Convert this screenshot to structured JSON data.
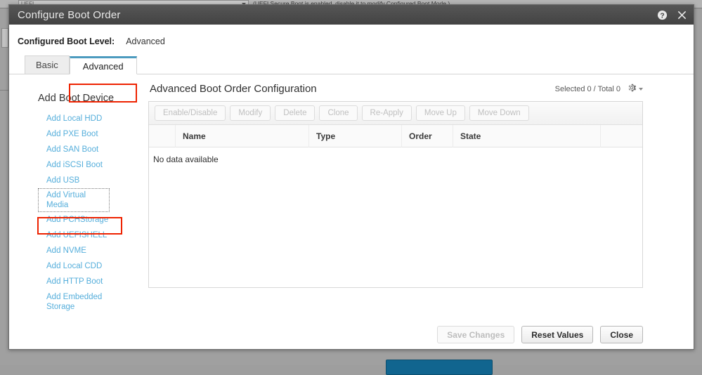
{
  "background": {
    "select_value": "UEFI",
    "note": "(UEFI Secure Boot is enabled, disable it to modify Configured Boot Mode.)"
  },
  "window": {
    "title": "Configure Boot Order",
    "help_icon": "help-circle-icon",
    "close_icon": "close-icon"
  },
  "boot_level": {
    "label": "Configured Boot Level:",
    "value": "Advanced"
  },
  "tabs": [
    {
      "label": "Basic",
      "active": false
    },
    {
      "label": "Advanced",
      "active": true
    }
  ],
  "sidebar": {
    "title": "Add Boot Device",
    "items": [
      {
        "label": "Add Local HDD"
      },
      {
        "label": "Add PXE Boot"
      },
      {
        "label": "Add SAN Boot"
      },
      {
        "label": "Add iSCSI Boot"
      },
      {
        "label": "Add USB"
      },
      {
        "label": "Add Virtual Media"
      },
      {
        "label": "Add PCHStorage"
      },
      {
        "label": "Add UEFISHELL"
      },
      {
        "label": "Add NVME"
      },
      {
        "label": "Add Local CDD"
      },
      {
        "label": "Add HTTP Boot"
      },
      {
        "label": "Add Embedded Storage"
      }
    ]
  },
  "main": {
    "title": "Advanced Boot Order Configuration",
    "selected_total": "Selected 0 / Total 0",
    "gear_icon": "gear-icon",
    "toolbar": [
      {
        "label": "Enable/Disable"
      },
      {
        "label": "Modify"
      },
      {
        "label": "Delete"
      },
      {
        "label": "Clone"
      },
      {
        "label": "Re-Apply"
      },
      {
        "label": "Move Up"
      },
      {
        "label": "Move Down"
      }
    ],
    "columns": [
      "",
      "Name",
      "Type",
      "Order",
      "State",
      ""
    ],
    "empty_message": "No data available"
  },
  "footer": {
    "save": "Save Changes",
    "reset": "Reset Values",
    "close": "Close"
  },
  "colors": {
    "link": "#55aedb",
    "accent_tab": "#4c9bbf",
    "highlight": "#ee2200",
    "titlebar": "#484848",
    "bg_button": "#11658f"
  }
}
